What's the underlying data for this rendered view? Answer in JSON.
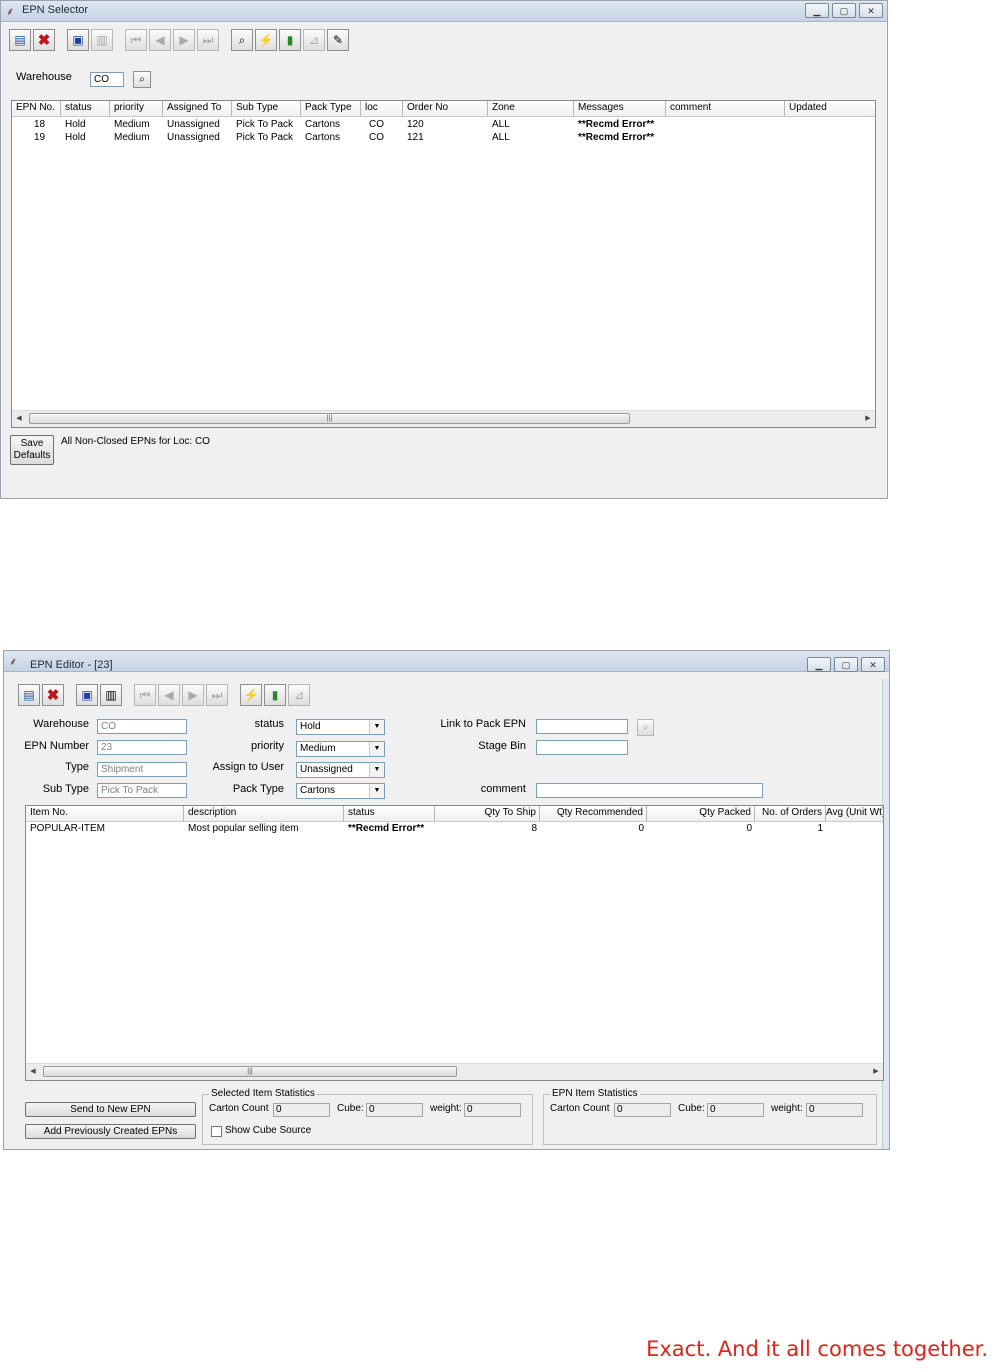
{
  "selector": {
    "title": "EPN Selector",
    "window_buttons": [
      "minimize",
      "maximize",
      "close"
    ],
    "toolbar": [
      "new-doc-icon",
      "delete-icon",
      "save-icon",
      "copy-icon",
      "first-icon",
      "prev-icon",
      "next-icon",
      "last-icon",
      "find-icon",
      "lightning-icon",
      "door-icon",
      "chart-icon",
      "edit-icon"
    ],
    "warehouse_label": "Warehouse",
    "warehouse_value": "CO",
    "columns": [
      "EPN No.",
      "status",
      "priority",
      "Assigned To",
      "Sub Type",
      "Pack Type",
      "loc",
      "Order No",
      "Zone",
      "Messages",
      "comment",
      "Updated"
    ],
    "rows": [
      [
        "18",
        "Hold",
        "Medium",
        "Unassigned",
        "Pick To Pack",
        "Cartons",
        "CO",
        "120",
        "ALL",
        "**Recmd Error**",
        "",
        ""
      ],
      [
        "19",
        "Hold",
        "Medium",
        "Unassigned",
        "Pick To Pack",
        "Cartons",
        "CO",
        "121",
        "ALL",
        "**Recmd Error**",
        "",
        ""
      ]
    ],
    "save_defaults_line1": "Save",
    "save_defaults_line2": "Defaults",
    "status_text": "All Non-Closed EPNs for Loc: CO"
  },
  "editor": {
    "title": "EPN Editor - [23]",
    "form": {
      "warehouse_label": "Warehouse",
      "warehouse_value": "CO",
      "epn_number_label": "EPN Number",
      "epn_number_value": "23",
      "type_label": "Type",
      "type_value": "Shipment",
      "sub_type_label": "Sub Type",
      "sub_type_value": "Pick To Pack",
      "status_label": "status",
      "status_value": "Hold",
      "priority_label": "priority",
      "priority_value": "Medium",
      "assign_label": "Assign to User",
      "assign_value": "Unassigned",
      "pack_type_label": "Pack Type",
      "pack_type_value": "Cartons",
      "link_label": "Link to Pack EPN",
      "link_value": "",
      "stage_bin_label": "Stage Bin",
      "stage_bin_value": "",
      "comment_label": "comment",
      "comment_value": ""
    },
    "columns": [
      "Item No.",
      "description",
      "status",
      "Qty To Ship",
      "Qty Recommended",
      "Qty Packed",
      "No. of Orders",
      "Avg (Unit Wt)"
    ],
    "rows": [
      [
        "POPULAR-ITEM",
        "Most popular selling item",
        "**Recmd Error**",
        "8",
        "0",
        "0",
        "1",
        ""
      ]
    ],
    "send_button": "Send to New EPN",
    "add_button": "Add Previously Created EPNs",
    "selected_stats": {
      "title": "Selected Item Statistics",
      "carton_label": "Carton Count",
      "carton_value": "0",
      "cube_label": "Cube:",
      "cube_value": "0",
      "weight_label": "weight:",
      "weight_value": "0",
      "show_cube_label": "Show Cube Source"
    },
    "epn_stats": {
      "title": "EPN Item Statistics",
      "carton_label": "Carton Count",
      "carton_value": "0",
      "cube_label": "Cube:",
      "cube_value": "0",
      "weight_label": "weight:",
      "weight_value": "0"
    }
  },
  "tagline": "Exact. And it all comes together.",
  "colors": {
    "tagline": "#e3231b",
    "titlebar": "#c5d3e4"
  }
}
